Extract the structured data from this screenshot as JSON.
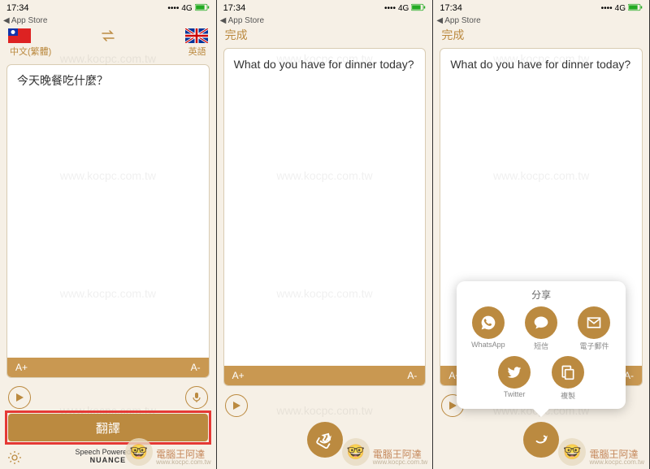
{
  "status": {
    "time": "17:34",
    "back_app": "App Store",
    "network": "4G",
    "signal_label": "signal",
    "battery_label": "battery"
  },
  "screen1": {
    "lang_from": "中文(繁體)",
    "lang_to": "英語",
    "input_text": "今天晚餐吃什麼？",
    "font_inc": "A+",
    "font_dec": "A-",
    "translate_label": "翻譯",
    "credit_line1": "Speech Powered by",
    "credit_line2": "NUANCE"
  },
  "screen2": {
    "done_label": "完成",
    "output_text": "What do you have for dinner today?",
    "font_inc": "A+",
    "font_dec": "A-"
  },
  "screen3": {
    "done_label": "完成",
    "output_text": "What do you have for dinner today?",
    "font_inc": "A+",
    "font_dec": "A-",
    "share_title": "分享",
    "share_items": [
      {
        "label": "WhatsApp",
        "icon": "whatsapp-icon"
      },
      {
        "label": "短信",
        "icon": "message-icon"
      },
      {
        "label": "電子郵件",
        "icon": "mail-icon"
      },
      {
        "label": "Twitter",
        "icon": "twitter-icon"
      },
      {
        "label": "複製",
        "icon": "copy-icon"
      }
    ]
  },
  "watermark": {
    "title": "電腦王阿達",
    "url": "www.kocpc.com.tw"
  }
}
